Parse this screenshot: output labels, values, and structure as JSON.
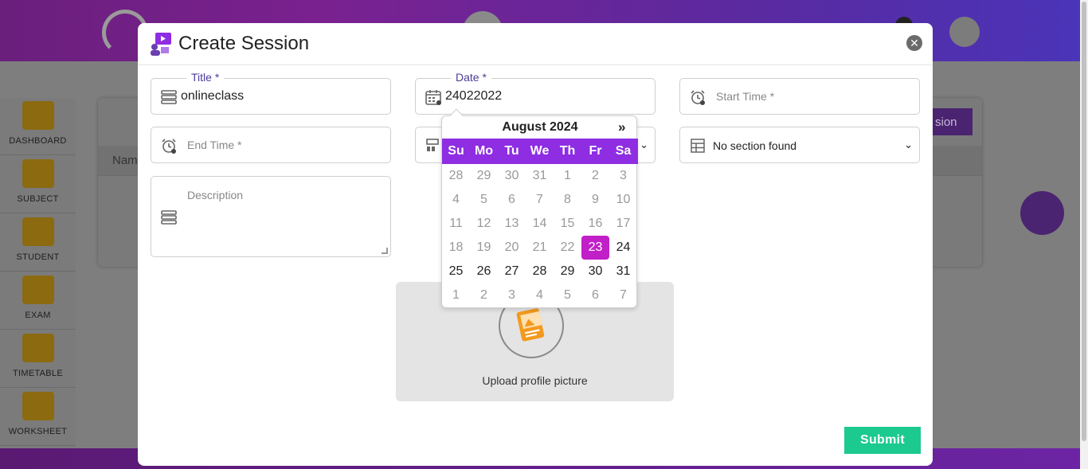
{
  "sidebar": {
    "items": [
      {
        "label": "DASHBOARD",
        "icon": "dashboard-icon"
      },
      {
        "label": "SUBJECT",
        "icon": "book-icon"
      },
      {
        "label": "STUDENT",
        "icon": "student-icon"
      },
      {
        "label": "EXAM",
        "icon": "exam-icon"
      },
      {
        "label": "TIMETABLE",
        "icon": "timetable-icon"
      },
      {
        "label": "WORKSHEET",
        "icon": "worksheet-icon"
      }
    ]
  },
  "background": {
    "table_header_name": "Nam",
    "create_button_partial": "sion"
  },
  "modal": {
    "title": "Create Session",
    "icon": "video-session-icon",
    "close_icon": "close-icon",
    "fields": {
      "title": {
        "label": "Title *",
        "value": "onlineclass"
      },
      "date": {
        "label": "Date *",
        "value": "24022022"
      },
      "start_time": {
        "placeholder": "Start Time *"
      },
      "end_time": {
        "placeholder": "End Time *"
      },
      "section": {
        "selected": "No section found"
      },
      "description": {
        "placeholder": "Description"
      }
    },
    "upload": {
      "label": "Upload profile picture"
    },
    "submit_label": "Submit"
  },
  "datepicker": {
    "month_label": "August 2024",
    "next_label": "»",
    "weekdays": [
      "Su",
      "Mo",
      "Tu",
      "We",
      "Th",
      "Fr",
      "Sa"
    ],
    "weeks": [
      [
        "28",
        "29",
        "30",
        "31",
        "1",
        "2",
        "3"
      ],
      [
        "4",
        "5",
        "6",
        "7",
        "8",
        "9",
        "10"
      ],
      [
        "11",
        "12",
        "13",
        "14",
        "15",
        "16",
        "17"
      ],
      [
        "18",
        "19",
        "20",
        "21",
        "22",
        "23",
        "24"
      ],
      [
        "25",
        "26",
        "27",
        "28",
        "29",
        "30",
        "31"
      ],
      [
        "1",
        "2",
        "3",
        "4",
        "5",
        "6",
        "7"
      ]
    ],
    "selected_day": "23",
    "colors": {
      "header": "#8e2de2",
      "selected": "#c11fc8"
    }
  },
  "colors": {
    "submit": "#1cc98f",
    "accent": "#4a3d9a"
  }
}
